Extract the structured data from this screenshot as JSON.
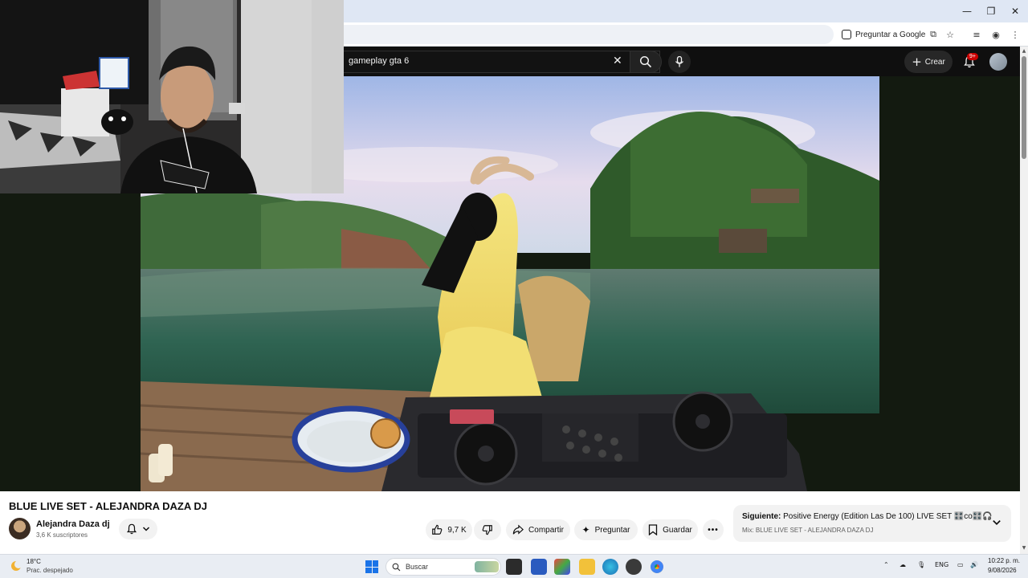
{
  "browser": {
    "ask_google_label": "Preguntar a Google"
  },
  "youtube": {
    "search_value": "gameplay gta 6",
    "create_label": "Crear",
    "notification_badge": "9+"
  },
  "video": {
    "title": "BLUE LIVE SET - ALEJANDRA DAZA DJ",
    "channel_name": "Alejandra Daza dj",
    "subscribers": "3,6 K suscriptores",
    "likes": "9,7 K",
    "share_label": "Compartir",
    "ask_label": "Preguntar",
    "save_label": "Guardar"
  },
  "up_next": {
    "prefix": "Siguiente:",
    "title": "Positive Energy (Edition Las De 100) LIVE SET",
    "emoji_tail": "🎛️co🎛️🎧",
    "mix_label": "Mix: BLUE LIVE SET - ALEJANDRA DAZA DJ"
  },
  "taskbar": {
    "weather_temp": "18°C",
    "weather_desc": "Prac. despejado",
    "search_placeholder": "Buscar",
    "language": "ENG",
    "time": "10:22 p. m.",
    "date": "9/08/2026"
  },
  "icons": {
    "window_minimize": "minimize-icon",
    "window_restore": "restore-icon",
    "window_close": "close-icon"
  }
}
